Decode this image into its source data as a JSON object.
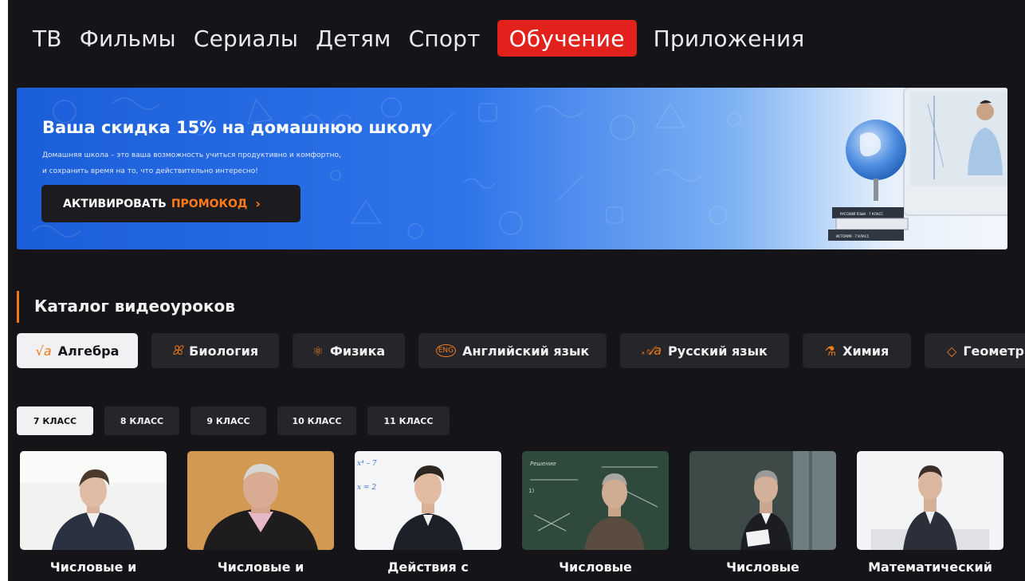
{
  "nav": {
    "items": [
      {
        "label": "ТВ"
      },
      {
        "label": "Фильмы"
      },
      {
        "label": "Сериалы"
      },
      {
        "label": "Детям"
      },
      {
        "label": "Спорт"
      },
      {
        "label": "Обучение",
        "active": true
      },
      {
        "label": "Приложения"
      }
    ]
  },
  "banner": {
    "title": "Ваша скидка 15% на домашнюю школу",
    "subtitle_line1": "Домашняя школа – это ваша возможность учиться продуктивно и комфортно,",
    "subtitle_line2": "и сохранить время на то, что действительно интересно!",
    "button_label": "АКТИВИРОВАТЬ",
    "button_accent": "ПРОМОКОД",
    "button_chevron": "›",
    "book1": "РУССКИЙ ЯЗЫК · 7 КЛАСС",
    "book2": "ИСТОРИЯ · 7 КЛАСС"
  },
  "catalog": {
    "title": "Каталог видеоуроков",
    "subjects": [
      {
        "label": "Алгебра",
        "icon": "√a",
        "icon_name": "sqrt-icon",
        "active": true
      },
      {
        "label": "Биология",
        "icon": "ꕤ",
        "icon_name": "dna-icon"
      },
      {
        "label": "Физика",
        "icon": "⚛",
        "icon_name": "atom-icon"
      },
      {
        "label": "Английский язык",
        "icon": "ENG",
        "icon_name": "eng-bubble-icon"
      },
      {
        "label": "Русский язык",
        "icon": "𝒜a",
        "icon_name": "letters-icon"
      },
      {
        "label": "Химия",
        "icon": "⚗",
        "icon_name": "flask-icon"
      },
      {
        "label": "Геометрия",
        "icon": "◇",
        "icon_name": "polygon-icon"
      }
    ],
    "grades": [
      {
        "label": "7 КЛАСС",
        "active": true
      },
      {
        "label": "8 КЛАСС"
      },
      {
        "label": "9 КЛАСС"
      },
      {
        "label": "10 КЛАСС"
      },
      {
        "label": "11 КЛАСС"
      }
    ],
    "videos": [
      {
        "title": "Числовые и"
      },
      {
        "title": "Числовые и"
      },
      {
        "title": "Действия с",
        "board1": "x⁴ – 7",
        "board2": "x = 2"
      },
      {
        "title": "Числовые",
        "board1": "Решение",
        "board2": "1)"
      },
      {
        "title": "Числовые"
      },
      {
        "title": "Математический"
      }
    ]
  },
  "colors": {
    "background": "#151519",
    "accent_red": "#e2211c",
    "accent_orange": "#f07a1b",
    "chip_bg": "#25252a",
    "chip_active_bg": "#f1f1f3"
  }
}
